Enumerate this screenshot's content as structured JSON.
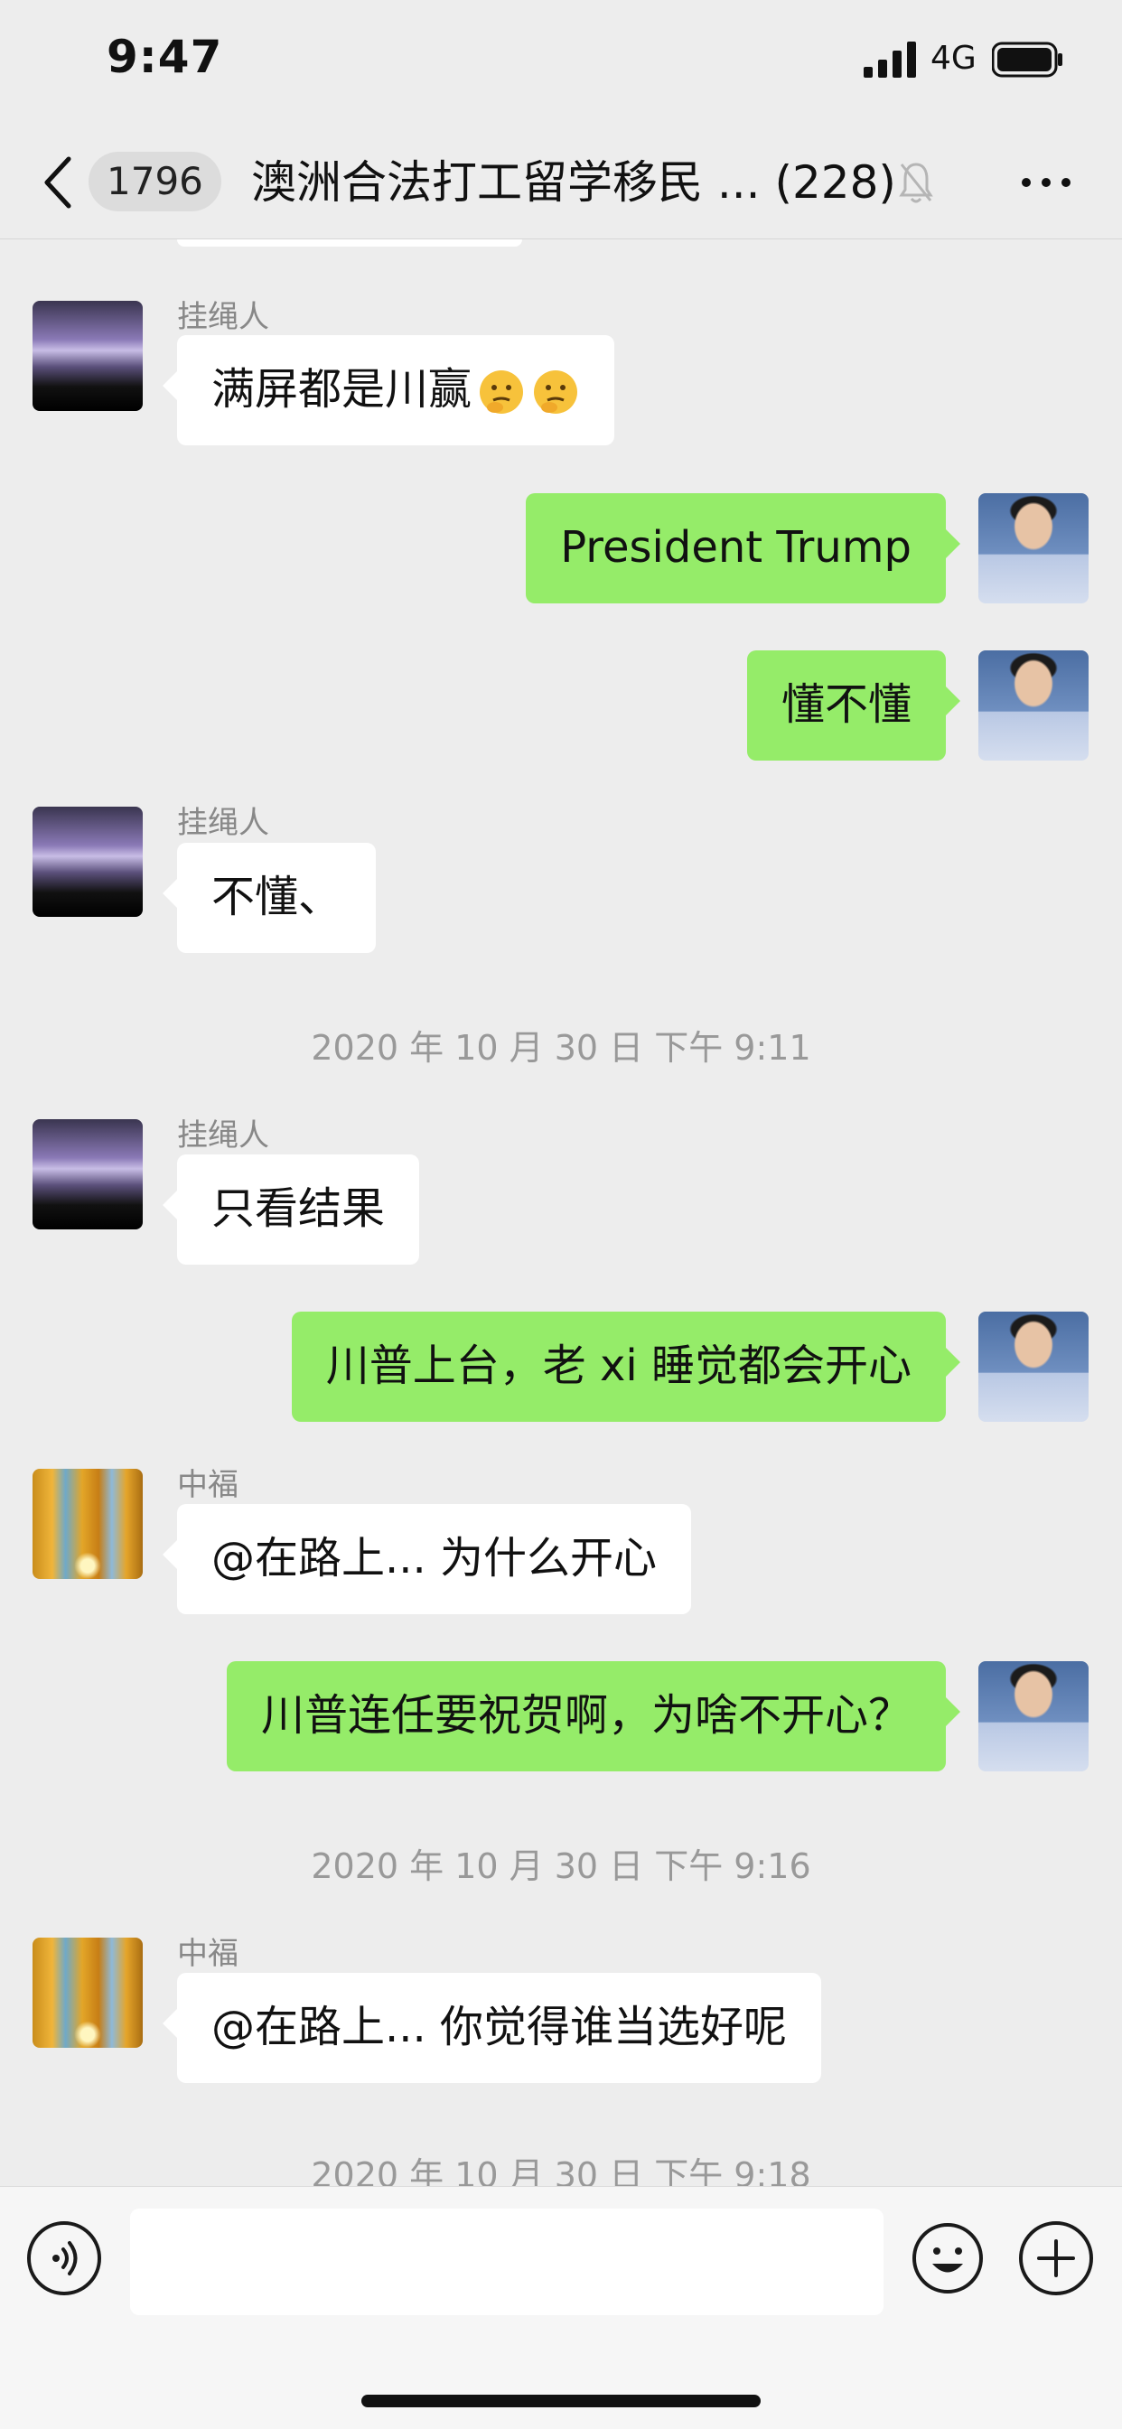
{
  "status_bar": {
    "time": "9:47",
    "network": "4G"
  },
  "nav": {
    "unread_count": "1796",
    "chat_title": "澳洲合法打工留学移民 ... (228)"
  },
  "messages": [
    {
      "side": "left",
      "sender": "挂绳人",
      "text": "满屏都是川赢",
      "emoji": "thinking-face"
    },
    {
      "side": "right",
      "text": "President Trump"
    },
    {
      "side": "right",
      "text": "懂不懂"
    },
    {
      "side": "left",
      "sender": "挂绳人",
      "text": "不懂、"
    },
    {
      "type": "timestamp",
      "text": "2020 年 10 月 30 日  下午 9:11"
    },
    {
      "side": "left",
      "sender": "挂绳人",
      "text": "只看结果"
    },
    {
      "side": "right",
      "text": "川普上台，老 xi 睡觉都会开心"
    },
    {
      "side": "left",
      "sender": "中福",
      "text": "@在路上... 为什么开心"
    },
    {
      "side": "right",
      "text": "川普连任要祝贺啊，为啥不开心？"
    },
    {
      "type": "timestamp",
      "text": "2020 年 10 月 30 日  下午 9:16"
    },
    {
      "side": "left",
      "sender": "中福",
      "text": "@在路上... 你觉得谁当选好呢"
    },
    {
      "type": "timestamp",
      "text": "2020 年 10 月 30 日  下午 9:18"
    }
  ],
  "input": {
    "value": "",
    "placeholder": ""
  },
  "colors": {
    "background": "#ededed",
    "self_bubble": "#95ec69",
    "other_bubble": "#ffffff"
  }
}
